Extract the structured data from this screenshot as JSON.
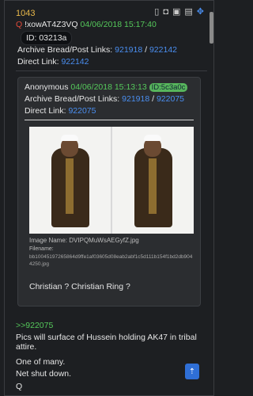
{
  "post": {
    "number": "1043",
    "q_mark": "Q",
    "tripcode": "!xowAT4Z3VQ",
    "date": "04/06/2018 15:17:40",
    "id_badge": "ID: 03213a",
    "archive_label": "Archive Bread/Post Links:",
    "archive_bread": "921918",
    "archive_post": "922142",
    "direct_label": "Direct Link:",
    "direct_link": "922142"
  },
  "quoted": {
    "name": "Anonymous",
    "date": "04/06/2018 15:13:13",
    "id": "ID:5c3a0c",
    "archive_label": "Archive Bread/Post Links:",
    "archive_bread": "921918",
    "archive_post": "922075",
    "direct_label": "Direct Link:",
    "direct_link": "922075",
    "image_name_label": "Image Name:",
    "image_name": "DVIPQMuWsAEGyfZ.jpg",
    "filename_label": "Filename:",
    "filename": "bb10045197265864d9ffe1af03605d08eab2abf1c5d111b154f1bd2db9044250.jpg",
    "text": "Christian ? Christian Ring ?"
  },
  "body": {
    "reply_ref": ">>922075",
    "lines": [
      "Pics will surface of Hussein holding AK47 in tribal attire.",
      "One of many.",
      "Net shut down.",
      "Q"
    ]
  },
  "icons": [
    "copy-icon",
    "goggles-icon",
    "image-icon",
    "layers-icon",
    "pin-icon"
  ],
  "colors": {
    "background": "#1d1f22",
    "accent_blue": "#4a8ef0",
    "date_green": "#55c95b",
    "q_red": "#e04a3a",
    "post_number_orange": "#e8b84a"
  }
}
